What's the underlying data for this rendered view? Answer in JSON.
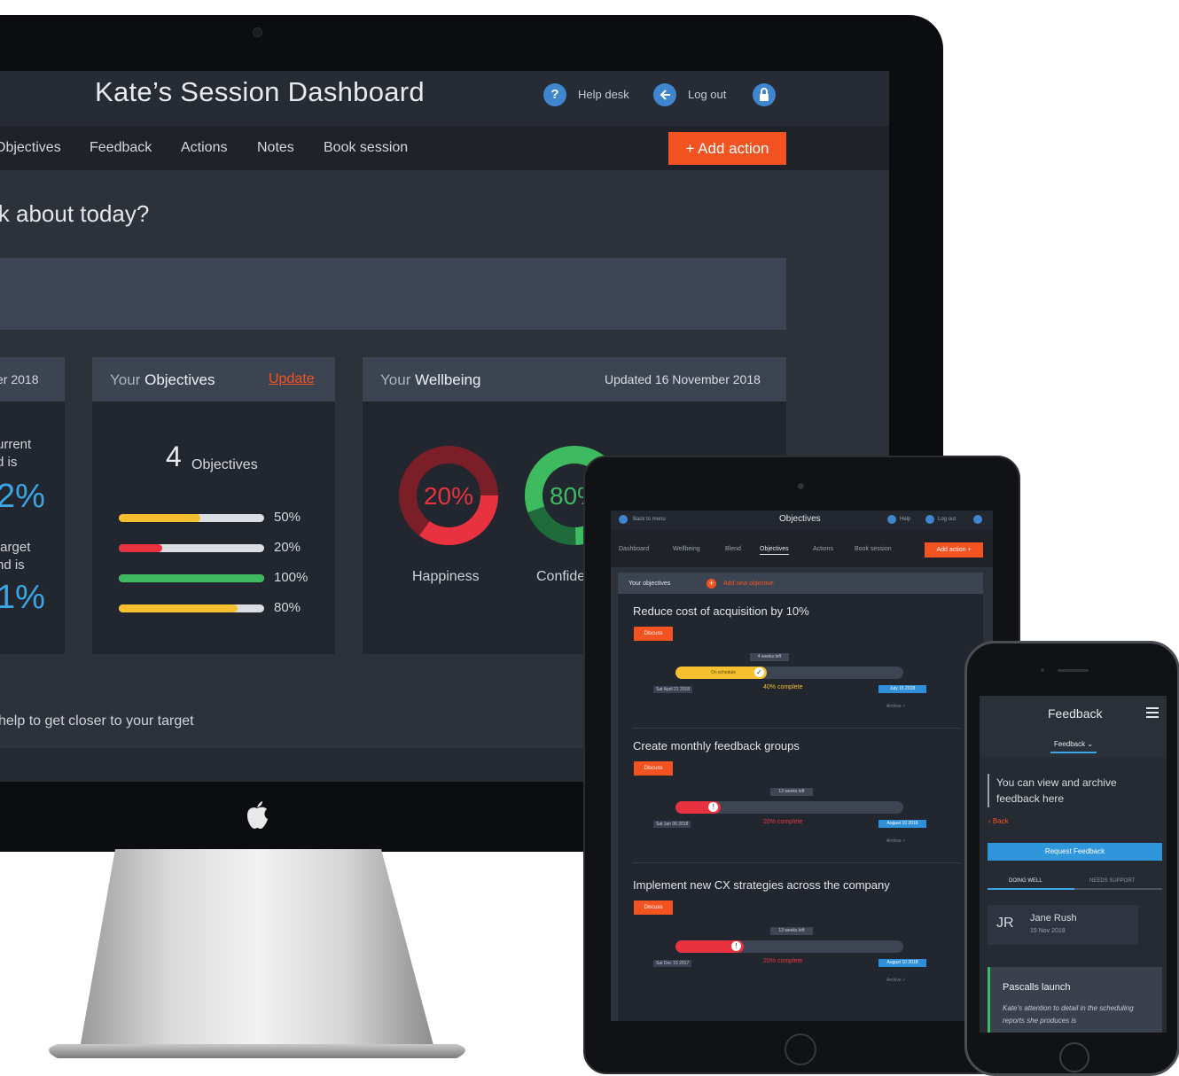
{
  "desktop": {
    "title": "Kate’s Session Dashboard",
    "header": {
      "help_icon_glyph": "?",
      "help_label": "Help desk",
      "logout_label": "Log out"
    },
    "nav": [
      "Objectives",
      "Feedback",
      "Actions",
      "Notes",
      "Book session"
    ],
    "add_action_label": "+  Add action",
    "question": "lk about today?",
    "left_card": {
      "header": "er 2018",
      "current_label_1": "urrent",
      "current_label_2": "d is",
      "current_pct": "2%",
      "target_label_1": "target",
      "target_label_2": "nd is",
      "target_pct": "1%"
    },
    "objectives_card": {
      "title_prefix": "Your",
      "title_main": "Objectives",
      "update_link": "Update",
      "count": "4",
      "count_label": "Objectives",
      "bars": [
        {
          "label": "50%",
          "value": 0.56,
          "color": "#f6bf2f"
        },
        {
          "label": "20%",
          "value": 0.3,
          "color": "#e8323f"
        },
        {
          "label": "100%",
          "value": 1.0,
          "color": "#3fbb5f"
        },
        {
          "label": "80%",
          "value": 0.82,
          "color": "#f6bf2f"
        }
      ]
    },
    "wellbeing_card": {
      "title_prefix": "Your",
      "title_main": "Wellbeing",
      "updated": "Updated 16 November 2018",
      "gauges": [
        {
          "label": "Happiness",
          "value_text": "20%",
          "value": 0.2,
          "color": "#e8323f"
        },
        {
          "label": "Confide",
          "value_text": "80%",
          "value": 0.8,
          "color": "#3fbb5f"
        }
      ]
    },
    "help_text": "help to get closer to your target"
  },
  "tablet": {
    "back_label": "Back to menu",
    "title": "Objectives",
    "help_label": "Help",
    "logout_label": "Log out",
    "nav": [
      "Dashboard",
      "Wellbeing",
      "Blend",
      "Objectives",
      "Actions",
      "Book session"
    ],
    "add_action_label": "Add action  +",
    "section_label": "Your objectives",
    "add_objective_label": "Add new objective",
    "objectives": [
      {
        "title": "Reduce cost of acquisition by 10%",
        "discuss": "Discuss",
        "weeks_left": "4 weeks left",
        "status": "On schedule",
        "progress": 0.4,
        "color": "#f6bf2f",
        "start": "Sat April 21 2018",
        "complete": "40% complete",
        "end": "July 15 2018",
        "archive": "Archive  ✓"
      },
      {
        "title": "Create monthly feedback groups",
        "discuss": "Discuss",
        "weeks_left": "13 weeks left",
        "status": "",
        "progress": 0.2,
        "color": "#e8323f",
        "start": "Sat Jan 06 2018",
        "complete": "20% complete",
        "end": "August 10 2018",
        "archive": "Archive  ✓"
      },
      {
        "title": "Implement new CX strategies across the company",
        "discuss": "Discuss",
        "weeks_left": "13 weeks left",
        "status": "",
        "progress": 0.3,
        "color": "#e8323f",
        "start": "Sat Dec 15 2017",
        "complete": "20% complete",
        "end": "August 10 2018",
        "archive": "Archive  ✓"
      }
    ]
  },
  "phone": {
    "title": "Feedback",
    "dropdown": "Feedback  ⌄",
    "info": "You can view and archive feedback here",
    "back": "‹ Back",
    "request_button": "Request Feedback",
    "tabs": [
      "DOING WELL",
      "NEEDS SUPPORT"
    ],
    "entry": {
      "initials": "JR",
      "name": "Jane Rush",
      "date": "15 Nov 2018"
    },
    "card": {
      "title": "Pascalls launch",
      "text": "Kate’s attention to detail in the scheduling reports she produces is"
    }
  }
}
